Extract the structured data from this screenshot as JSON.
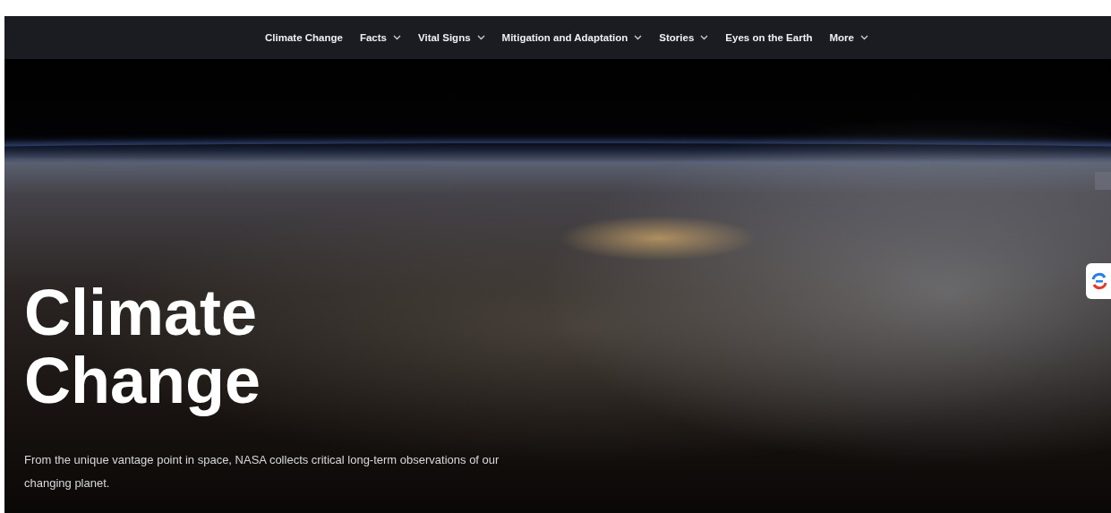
{
  "nav": {
    "items": [
      {
        "label": "Climate Change",
        "dropdown": false
      },
      {
        "label": "Facts",
        "dropdown": true
      },
      {
        "label": "Vital Signs",
        "dropdown": true
      },
      {
        "label": "Mitigation and Adaptation",
        "dropdown": true
      },
      {
        "label": "Stories",
        "dropdown": true
      },
      {
        "label": "Eyes on the Earth",
        "dropdown": false
      },
      {
        "label": "More",
        "dropdown": true
      }
    ]
  },
  "hero": {
    "title": "Climate Change",
    "description": "From the unique vantage point in space, NASA collects critical long-term observations of our changing planet."
  }
}
